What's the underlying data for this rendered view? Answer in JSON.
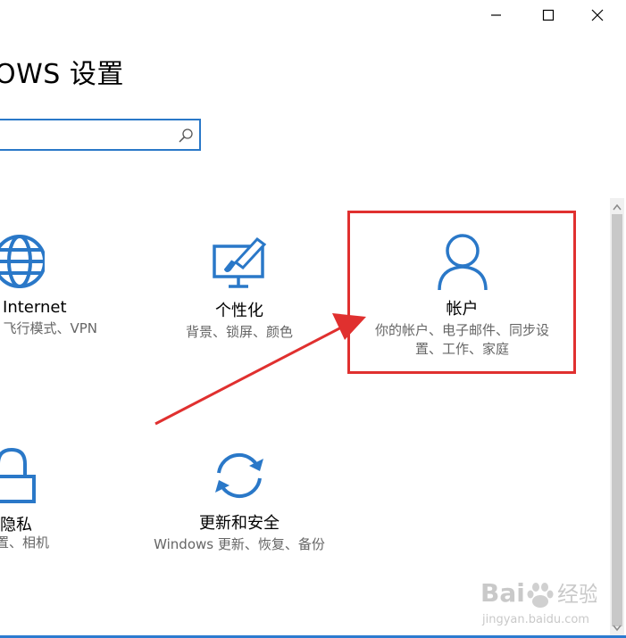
{
  "window": {
    "title": "OWS 设置",
    "controls": {
      "minimize": "minimize-icon",
      "maximize": "maximize-icon",
      "close": "close-icon"
    }
  },
  "search": {
    "value": "",
    "placeholder": "",
    "icon": "search-icon"
  },
  "tiles": [
    {
      "name": "I Internet",
      "desc": "& 飞行模式、VPN",
      "icon": "globe-icon"
    },
    {
      "name": "个性化",
      "desc": "背景、锁屏、颜色",
      "icon": "personalization-icon"
    },
    {
      "name": "帐户",
      "desc": "你的帐户、电子邮件、同步设置、工作、家庭",
      "icon": "person-icon"
    },
    {
      "name": "隐私",
      "desc": "置、相机",
      "icon": "lock-icon"
    },
    {
      "name": "更新和安全",
      "desc": "Windows 更新、恢复、备份",
      "icon": "update-icon"
    }
  ],
  "annotation": {
    "highlight_color": "#e0302f",
    "arrow_color": "#e0302f"
  },
  "accent_color": "#2a78c8",
  "watermark": {
    "brand": "Bai du 经验",
    "url": "jingyan.baidu.com"
  }
}
